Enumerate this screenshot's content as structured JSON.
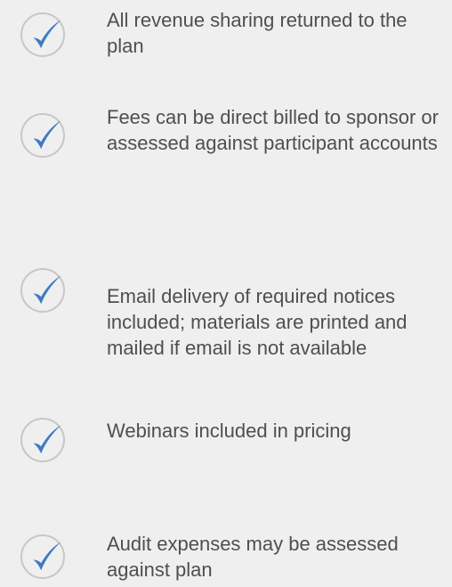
{
  "features": {
    "items": [
      {
        "text": "All revenue sharing returned to the plan",
        "icon": "checkmark-circle-icon"
      },
      {
        "text": "Fees can be direct billed to sponsor or assessed against participant accounts",
        "icon": "checkmark-circle-icon"
      },
      {
        "text": "Email delivery of required notices included; materials are printed and mailed if email is not available",
        "icon": "checkmark-circle-icon"
      },
      {
        "text": "Webinars included in pricing",
        "icon": "checkmark-circle-icon"
      },
      {
        "text": "Audit expenses may be assessed against plan",
        "icon": "checkmark-circle-icon"
      }
    ]
  },
  "colors": {
    "background": "#efefef",
    "text": "#4f4f4f",
    "circle": "#c7c7c7",
    "check": "#3f7ac3"
  }
}
